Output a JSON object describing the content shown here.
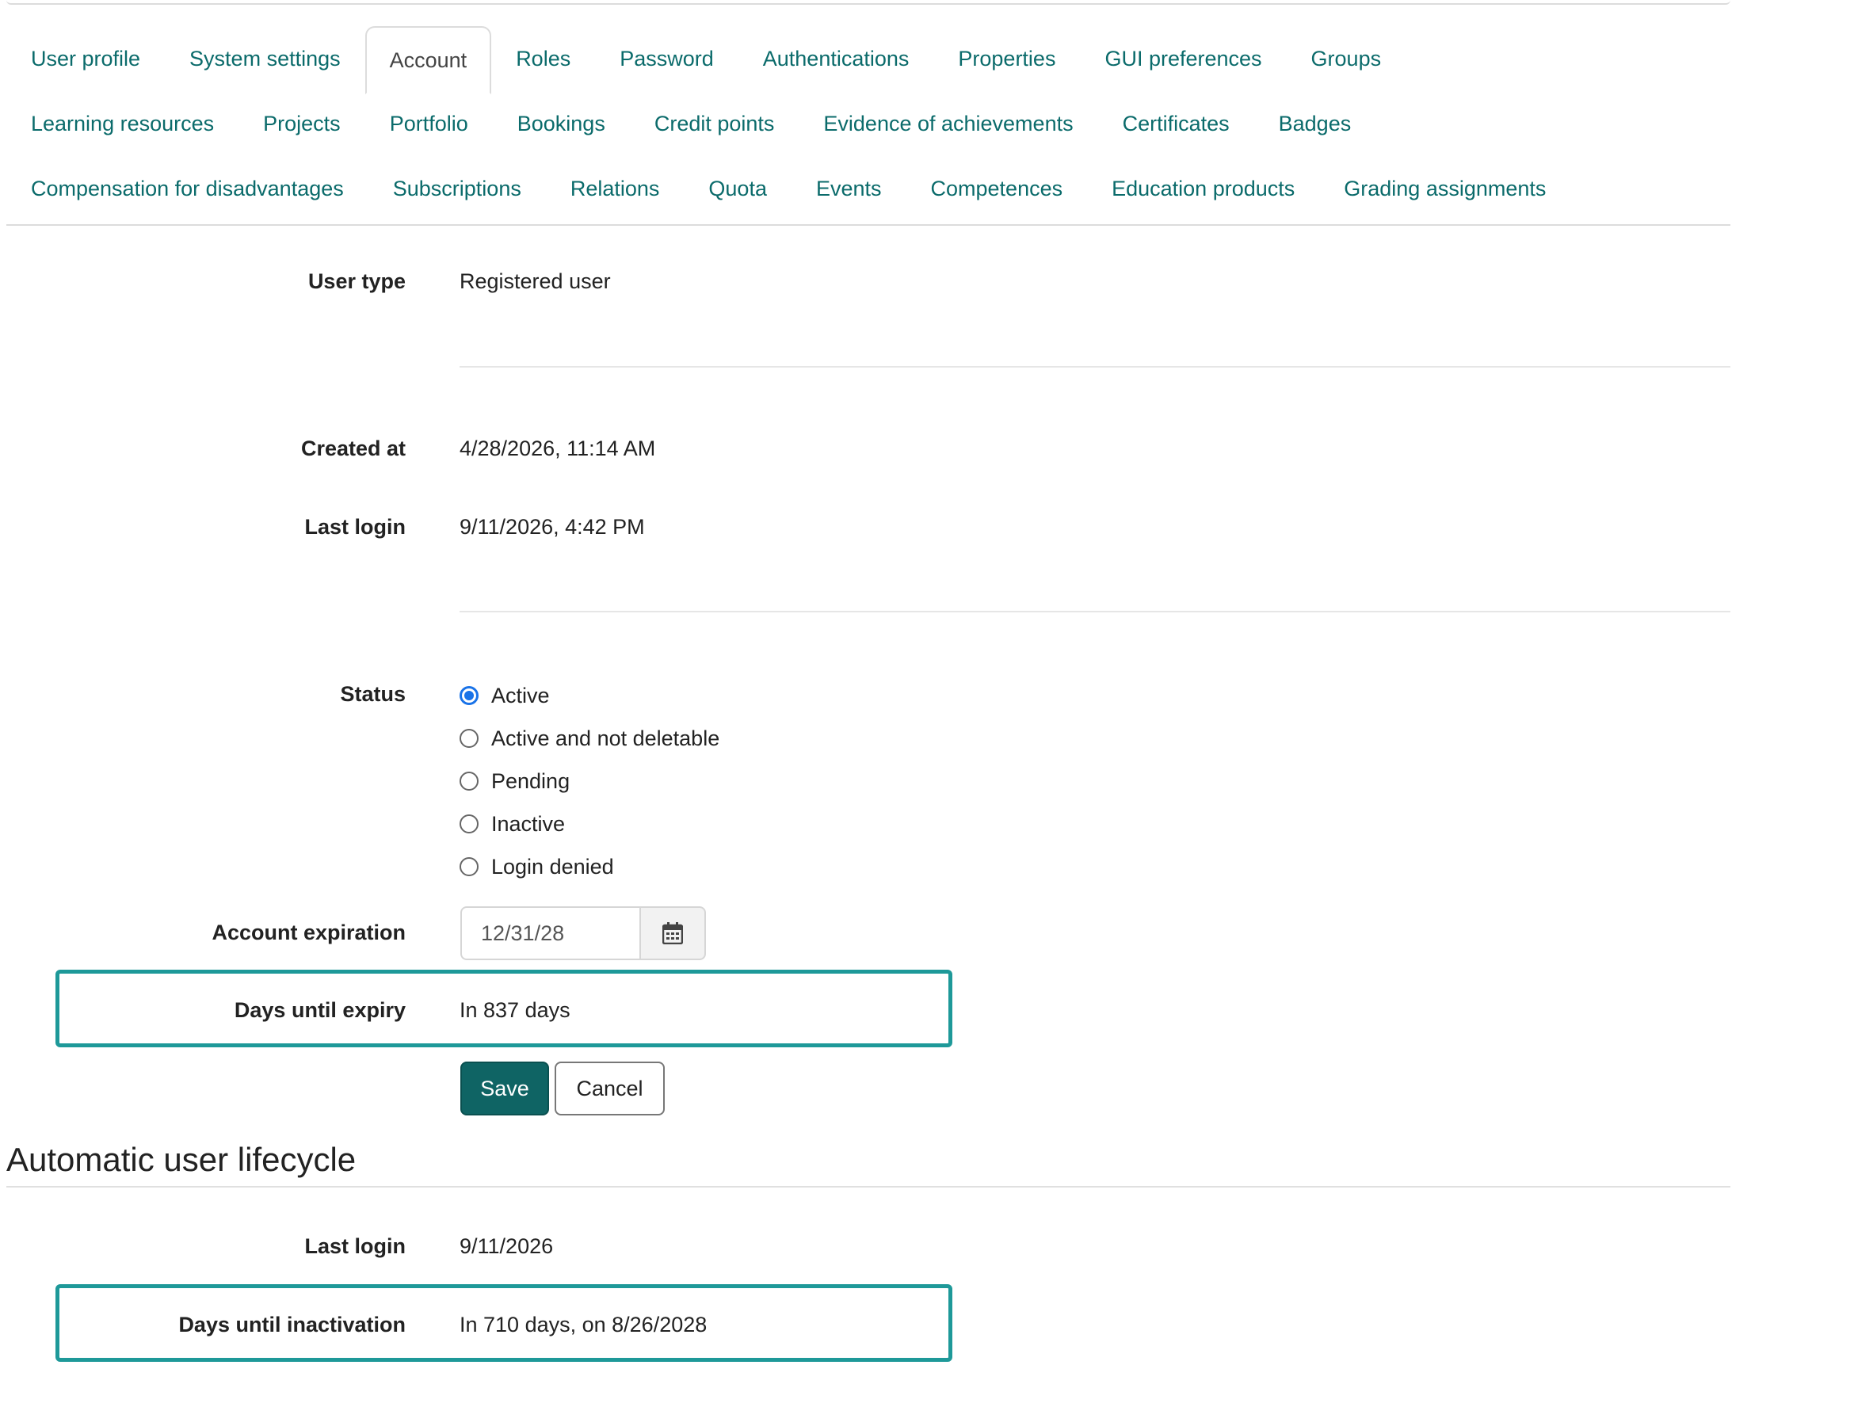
{
  "tabs": {
    "rows": [
      [
        "User profile",
        "System settings",
        "Account",
        "Roles",
        "Password",
        "Authentications",
        "Properties",
        "GUI preferences",
        "Groups"
      ],
      [
        "Learning resources",
        "Projects",
        "Portfolio",
        "Bookings",
        "Credit points",
        "Evidence of achievements",
        "Certificates",
        "Badges"
      ],
      [
        "Compensation for disadvantages",
        "Subscriptions",
        "Relations",
        "Quota",
        "Events",
        "Competences",
        "Education products",
        "Grading assignments"
      ]
    ],
    "active": "Account"
  },
  "account": {
    "user_type_label": "User type",
    "user_type_value": "Registered user",
    "created_label": "Created at",
    "created_value": "4/28/2026, 11:14 AM",
    "last_login_label": "Last login",
    "last_login_value": "9/11/2026, 4:42 PM",
    "status_label": "Status",
    "status_options": [
      "Active",
      "Active and not deletable",
      "Pending",
      "Inactive",
      "Login denied"
    ],
    "status_selected": "Active",
    "expiration_label": "Account expiration",
    "expiration_value": "12/31/28",
    "days_until_expiry_label": "Days until expiry",
    "days_until_expiry_value": "In 837 days",
    "save_label": "Save",
    "cancel_label": "Cancel"
  },
  "lifecycle": {
    "title": "Automatic user lifecycle",
    "last_login_label": "Last login",
    "last_login_value": "9/11/2026",
    "inactivation_label": "Days until inactivation",
    "inactivation_value": "In 710 days, on 8/26/2028"
  },
  "colors": {
    "link": "#0b6b6b",
    "highlight_border": "#1e9999",
    "save_button": "#0f6464",
    "radio_selected": "#1a73e8"
  },
  "icons": {
    "date_picker": "calendar-icon"
  }
}
